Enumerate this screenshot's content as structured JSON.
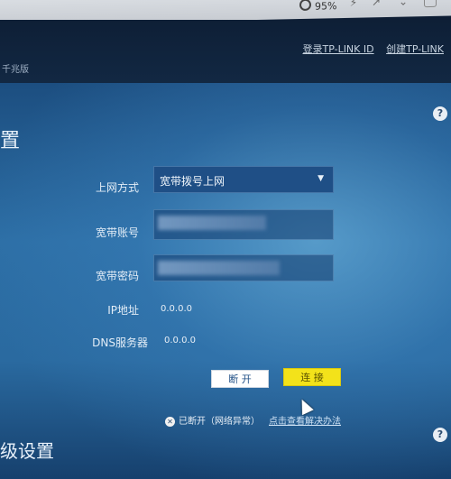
{
  "browser": {
    "zoom": "95%"
  },
  "header": {
    "brand": "千兆版",
    "links": [
      "登录TP-LINK ID",
      "创建TP-LINK"
    ]
  },
  "section": {
    "title": "置",
    "next_title": "级设置"
  },
  "form": {
    "connection_type_label": "上网方式",
    "connection_type_value": "宽带拨号上网",
    "account_label": "宽带账号",
    "password_label": "宽带密码",
    "ip_label": "IP地址",
    "ip_value": "0.0.0.0",
    "dns_label": "DNS服务器",
    "dns_value": "0.0.0.0"
  },
  "buttons": {
    "disconnect": "断 开",
    "connect": "连 接"
  },
  "status": {
    "text": "已断开（网络异常）",
    "link": "点击查看解决办法"
  },
  "help": "?",
  "colors": {
    "connect_button": "#f3e21a",
    "panel_blue": "#2d6fa6"
  }
}
